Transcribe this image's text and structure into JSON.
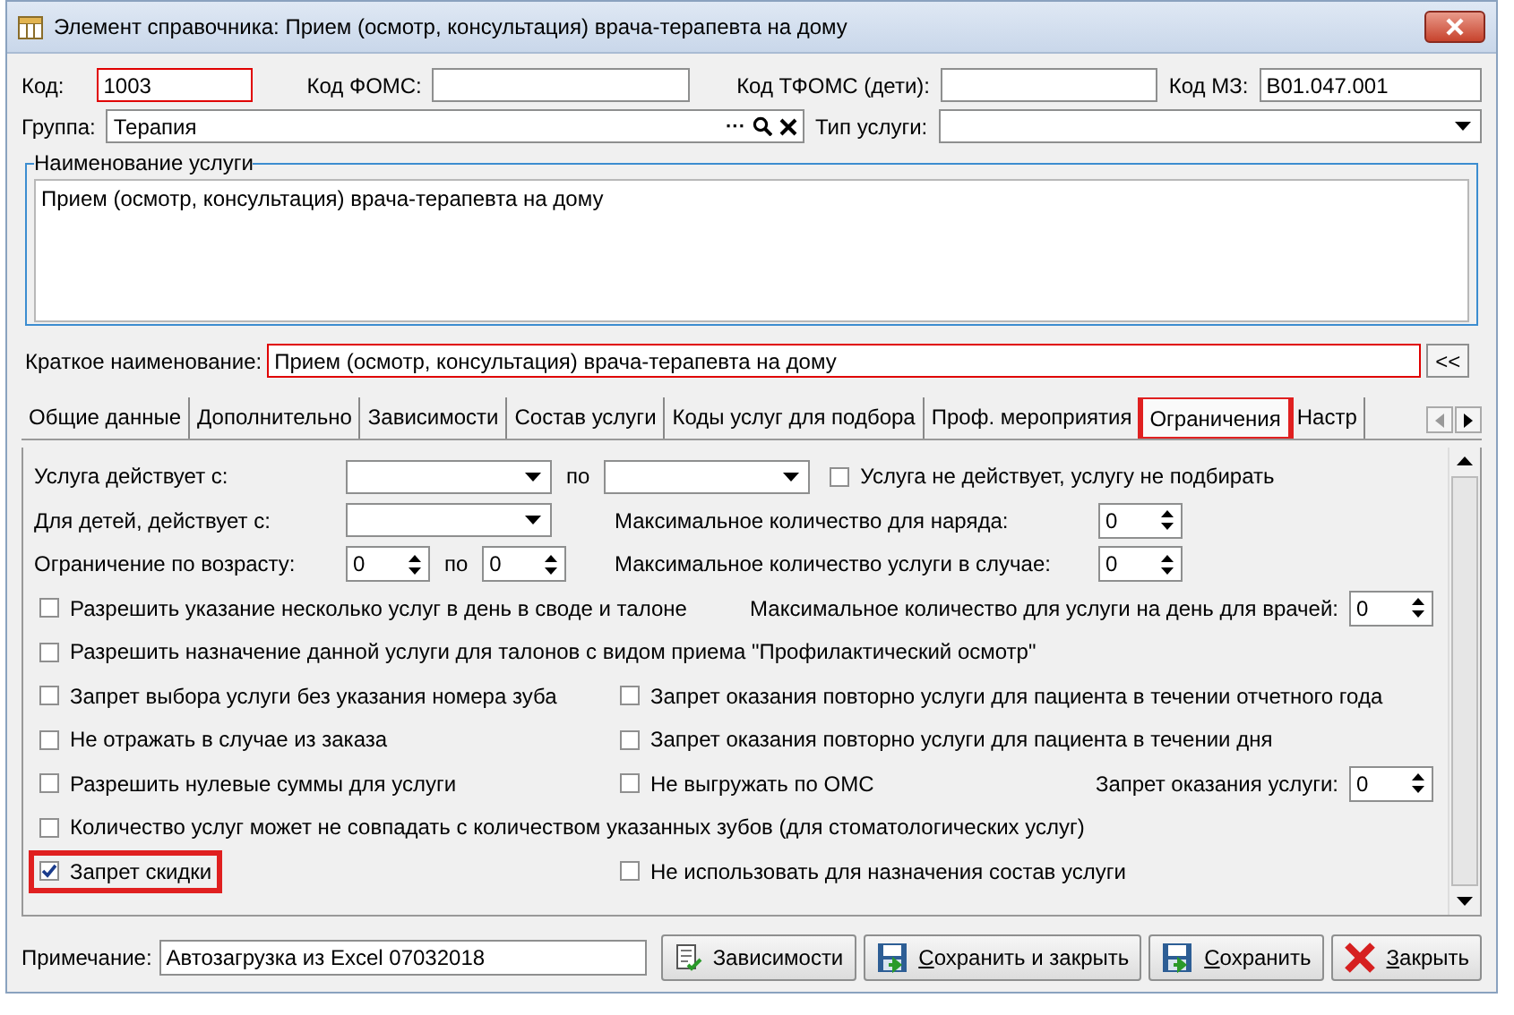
{
  "window": {
    "title": "Элемент справочника: Прием (осмотр, консультация) врача-терапевта на дому"
  },
  "codes": [
    {
      "label": "Код:",
      "value": "1003",
      "required": true
    },
    {
      "label": "Код ФОМС:",
      "required": false
    },
    {
      "label": "Код ТФОМС (дети):",
      "required": false
    },
    {
      "label": "Код МЗ:",
      "value": "B01.047.001",
      "required": false
    }
  ],
  "group": {
    "label": "Группа:",
    "value": "Терапия",
    "ellipsis": "···"
  },
  "service_type": {
    "label": "Тип услуги:"
  },
  "name_box": {
    "legend": "Наименование услуги",
    "value": "Прием (осмотр, консультация) врача-терапевта на дому"
  },
  "short_name": {
    "label": "Краткое наименование:",
    "value": "Прием (осмотр, консультация) врача-терапевта на дому",
    "button": "<<"
  },
  "tabs": [
    {
      "label": "Общие данные",
      "selected": false,
      "highlighted": false
    },
    {
      "label": "Дополнительно",
      "selected": false,
      "highlighted": false
    },
    {
      "label": "Зависимости",
      "selected": false,
      "highlighted": false
    },
    {
      "label": "Состав услуги",
      "selected": false,
      "highlighted": false
    },
    {
      "label": "Коды услуг для подбора",
      "selected": false,
      "highlighted": false
    },
    {
      "label": "Проф. мероприятия",
      "selected": false,
      "highlighted": false
    },
    {
      "label": "Ограничения",
      "selected": true,
      "highlighted": true
    },
    {
      "label": "Настр",
      "selected": false,
      "highlighted": false
    }
  ],
  "rows": [
    {
      "left": [
        {
          "kind": "label",
          "text": "Услуга действует с:"
        },
        {
          "kind": "dropdown"
        },
        {
          "kind": "text",
          "text": "по"
        },
        {
          "kind": "dropdown"
        },
        {
          "kind": "checkbox",
          "text": "Услуга не действует, услугу не подбирать",
          "checked": false,
          "highlighted": false
        }
      ]
    },
    {
      "left": [
        {
          "kind": "label",
          "text": "Для детей, действует с:"
        },
        {
          "kind": "dropdown"
        }
      ],
      "right": [
        {
          "kind": "label",
          "text": "Максимальное количество для наряда:"
        },
        {
          "kind": "spin",
          "value": "0"
        }
      ]
    },
    {
      "left": [
        {
          "kind": "label",
          "text": "Ограничение по возрасту:"
        },
        {
          "kind": "spin",
          "value": "0"
        },
        {
          "kind": "text",
          "text": "по"
        },
        {
          "kind": "spin",
          "value": "0"
        }
      ],
      "right": [
        {
          "kind": "label",
          "text": "Максимальное количество услуги в случае:"
        },
        {
          "kind": "spin",
          "value": "0"
        }
      ]
    },
    {
      "left": [
        {
          "kind": "checkbox",
          "text": "Разрешить указание несколько услуг в день в своде и талоне",
          "checked": false,
          "highlighted": false
        }
      ],
      "far": [
        {
          "kind": "text",
          "text": "Максимальное количество для услуги на день для врачей:"
        },
        {
          "kind": "spin",
          "value": "0"
        }
      ]
    },
    {
      "left": [
        {
          "kind": "checkbox",
          "text": "Разрешить назначение данной услуги для талонов с видом приема \"Профилактический осмотр\"",
          "checked": false,
          "highlighted": false
        }
      ]
    },
    {
      "left": [
        {
          "kind": "checkbox",
          "text": "Запрет выбора услуги без указания номера зуба",
          "checked": false,
          "highlighted": false
        }
      ],
      "right": [
        {
          "kind": "checkbox",
          "text": "Запрет оказания повторно услуги для пациента в течении отчетного года",
          "checked": false,
          "highlighted": false
        }
      ]
    },
    {
      "left": [
        {
          "kind": "checkbox",
          "text": "Не отражать в случае из заказа",
          "checked": false,
          "highlighted": false
        }
      ],
      "right": [
        {
          "kind": "checkbox",
          "text": "Запрет оказания повторно услуги для пациента в течении дня",
          "checked": false,
          "highlighted": false
        }
      ]
    },
    {
      "left": [
        {
          "kind": "checkbox",
          "text": "Разрешить нулевые суммы для услуги",
          "checked": false,
          "highlighted": false
        }
      ],
      "right": [
        {
          "kind": "checkbox",
          "text": "Не выгружать по ОМС",
          "checked": false,
          "highlighted": false
        }
      ],
      "far": [
        {
          "kind": "text",
          "text": "Запрет оказания услуги:"
        },
        {
          "kind": "spin",
          "value": "0"
        }
      ]
    },
    {
      "left": [
        {
          "kind": "checkbox",
          "text": "Количество услуг может не совпадать с количеством указанных зубов (для стоматологических услуг)",
          "checked": false,
          "highlighted": false
        }
      ]
    },
    {
      "left": [
        {
          "kind": "checkbox",
          "text": "Запрет скидки",
          "checked": true,
          "highlighted": true
        }
      ],
      "right": [
        {
          "kind": "checkbox",
          "text": "Не использовать для назначения состав услуги",
          "checked": false,
          "highlighted": false
        }
      ]
    }
  ],
  "note": {
    "label": "Примечание:",
    "value": "Автозагрузка из Excel 07032018"
  },
  "buttons": [
    {
      "label": "Зависимости",
      "kind": "links",
      "mnemonic": false
    },
    {
      "label": "Сохранить и закрыть",
      "kind": "save_close",
      "mnemonic": true
    },
    {
      "label": "Сохранить",
      "kind": "save",
      "mnemonic": true
    },
    {
      "label": "Закрыть",
      "kind": "close",
      "mnemonic": true
    }
  ]
}
